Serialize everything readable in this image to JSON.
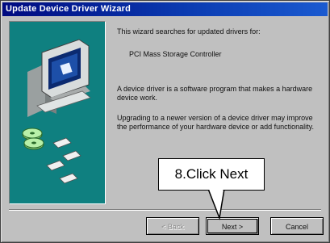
{
  "window": {
    "title": "Update Device Driver Wizard"
  },
  "body": {
    "intro": "This wizard searches for updated drivers for:",
    "device": "PCI Mass Storage Controller",
    "definition": "A device driver is a software program that makes a hardware device work.",
    "upgrade_note": "Upgrading to a newer version of a device driver may improve the performance of your hardware device or add functionality."
  },
  "buttons": {
    "back": "< Back",
    "next": "Next >",
    "cancel": "Cancel"
  },
  "annotation": {
    "label": "8.Click Next"
  },
  "colors": {
    "title_bar": "#000a80",
    "panel": "#0f8080",
    "window": "#c0c0c0"
  },
  "icons": [
    "computer-icon",
    "monitor-icon",
    "disk-icon"
  ]
}
